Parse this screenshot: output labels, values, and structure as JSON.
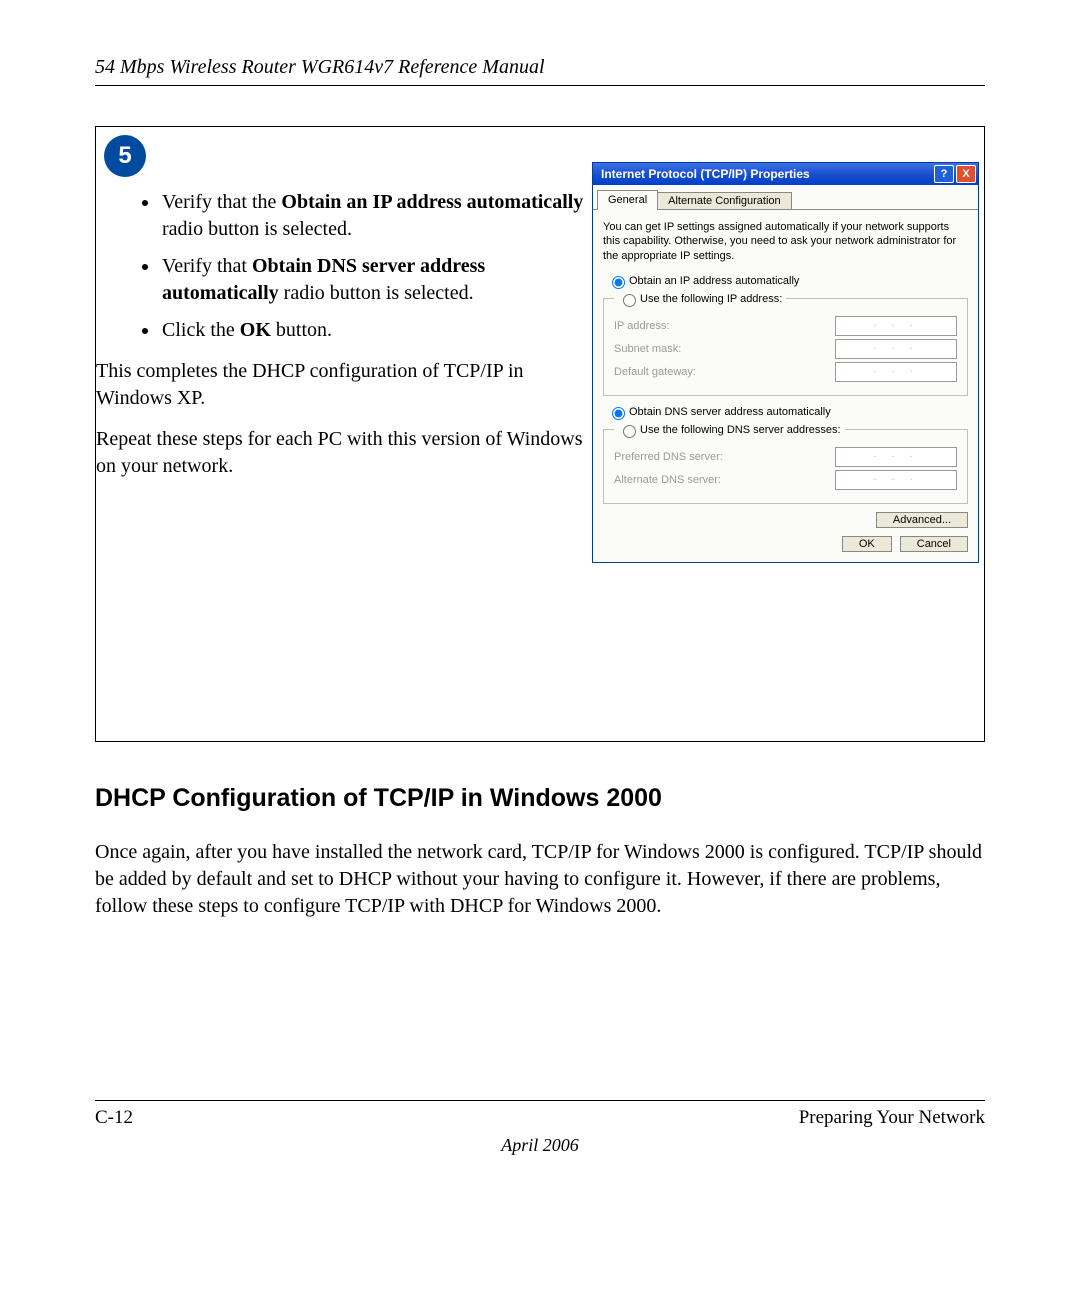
{
  "running_head": "54 Mbps Wireless Router WGR614v7 Reference Manual",
  "step_number": "5",
  "bullet1_pre": "Verify that the ",
  "bullet1_bold": "Obtain an IP address automatically",
  "bullet1_post": " radio button is selected.",
  "bullet2_pre": "Verify that ",
  "bullet2_bold": "Obtain DNS server address automatically",
  "bullet2_post": " radio button is selected.",
  "bullet3_pre": "Click the ",
  "bullet3_bold": "OK",
  "bullet3_post": " button.",
  "para1": "This completes the DHCP configuration of TCP/IP in Windows XP.",
  "para2": "Repeat these steps for each PC with this version of Windows on your network.",
  "dialog": {
    "title": "Internet Protocol (TCP/IP) Properties",
    "help": "?",
    "close": "X",
    "tab_general": "General",
    "tab_alt": "Alternate Configuration",
    "desc": "You can get IP settings assigned automatically if your network supports this capability. Otherwise, you need to ask your network administrator for the appropriate IP settings.",
    "r_obtain_ip": "Obtain an IP address automatically",
    "r_use_ip": "Use the following IP address:",
    "lbl_ip": "IP address:",
    "lbl_mask": "Subnet mask:",
    "lbl_gw": "Default gateway:",
    "r_obtain_dns": "Obtain DNS server address automatically",
    "r_use_dns": "Use the following DNS server addresses:",
    "lbl_pdns": "Preferred DNS server:",
    "lbl_adns": "Alternate DNS server:",
    "btn_adv": "Advanced...",
    "btn_ok": "OK",
    "btn_cancel": "Cancel",
    "ip_dots": ".  .  ."
  },
  "section_heading": "DHCP Configuration of TCP/IP in Windows 2000",
  "body_para": "Once again, after you have installed the network card, TCP/IP for Windows 2000 is configured. TCP/IP should be added by default and set to DHCP without your having to configure it. However, if there are problems, follow these steps to configure TCP/IP with DHCP for Windows 2000.",
  "footer_page": "C-12",
  "footer_chapter": "Preparing Your Network",
  "footer_date": "April 2006"
}
